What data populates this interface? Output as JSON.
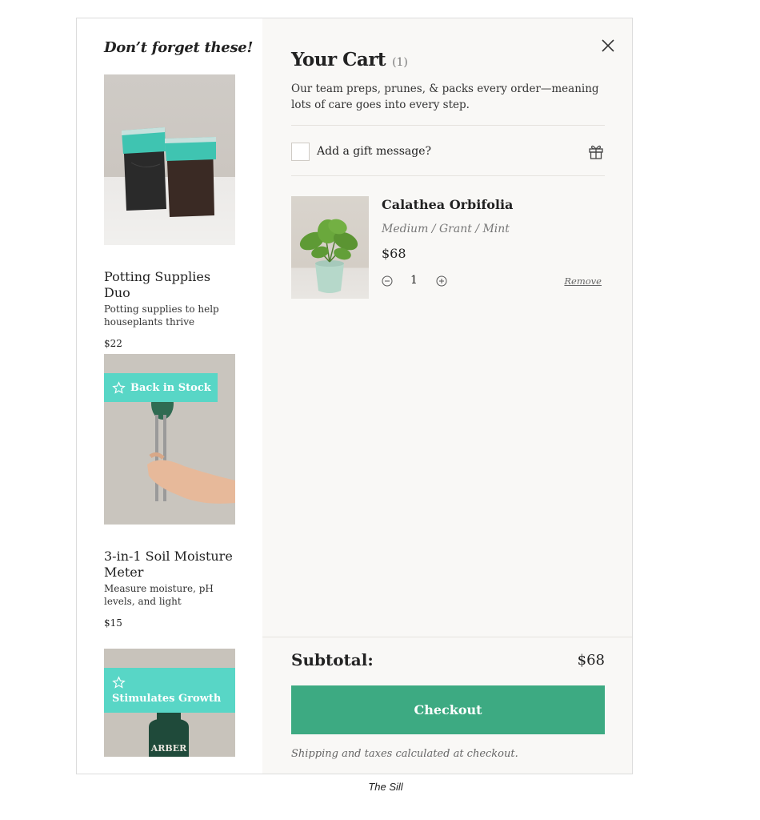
{
  "upsell": {
    "heading": "Don’t forget these!",
    "products": [
      {
        "name": "Potting Supplies Duo",
        "description": "Potting supplies to help houseplants thrive",
        "price": "$22"
      },
      {
        "name": "3-in-1 Soil Moisture Meter",
        "description": "Measure moisture, pH levels, and light",
        "price": "$15",
        "badge": "Back in Stock"
      },
      {
        "badge": "Stimulates Growth",
        "bottle_label": "ARBER"
      }
    ]
  },
  "cart": {
    "title": "Your Cart",
    "count": "(1)",
    "intro": "Our team preps, prunes, & packs every order—meaning lots of care goes into every step.",
    "gift_label": "Add a gift message?",
    "items": [
      {
        "name": "Calathea Orbifolia",
        "variant": "Medium / Grant / Mint",
        "price": "$68",
        "quantity": "1",
        "remove_label": "Remove"
      }
    ],
    "subtotal_label": "Subtotal:",
    "subtotal_value": "$68",
    "checkout_label": "Checkout",
    "shipping_note": "Shipping and taxes calculated at checkout."
  },
  "caption": "The Sill",
  "colors": {
    "checkout": "#3daa82",
    "badge": "#58d6c6",
    "cart_bg": "#f9f8f6"
  },
  "icons": [
    "close-icon",
    "gift-icon",
    "star-icon",
    "minus-circle-icon",
    "plus-circle-icon"
  ]
}
